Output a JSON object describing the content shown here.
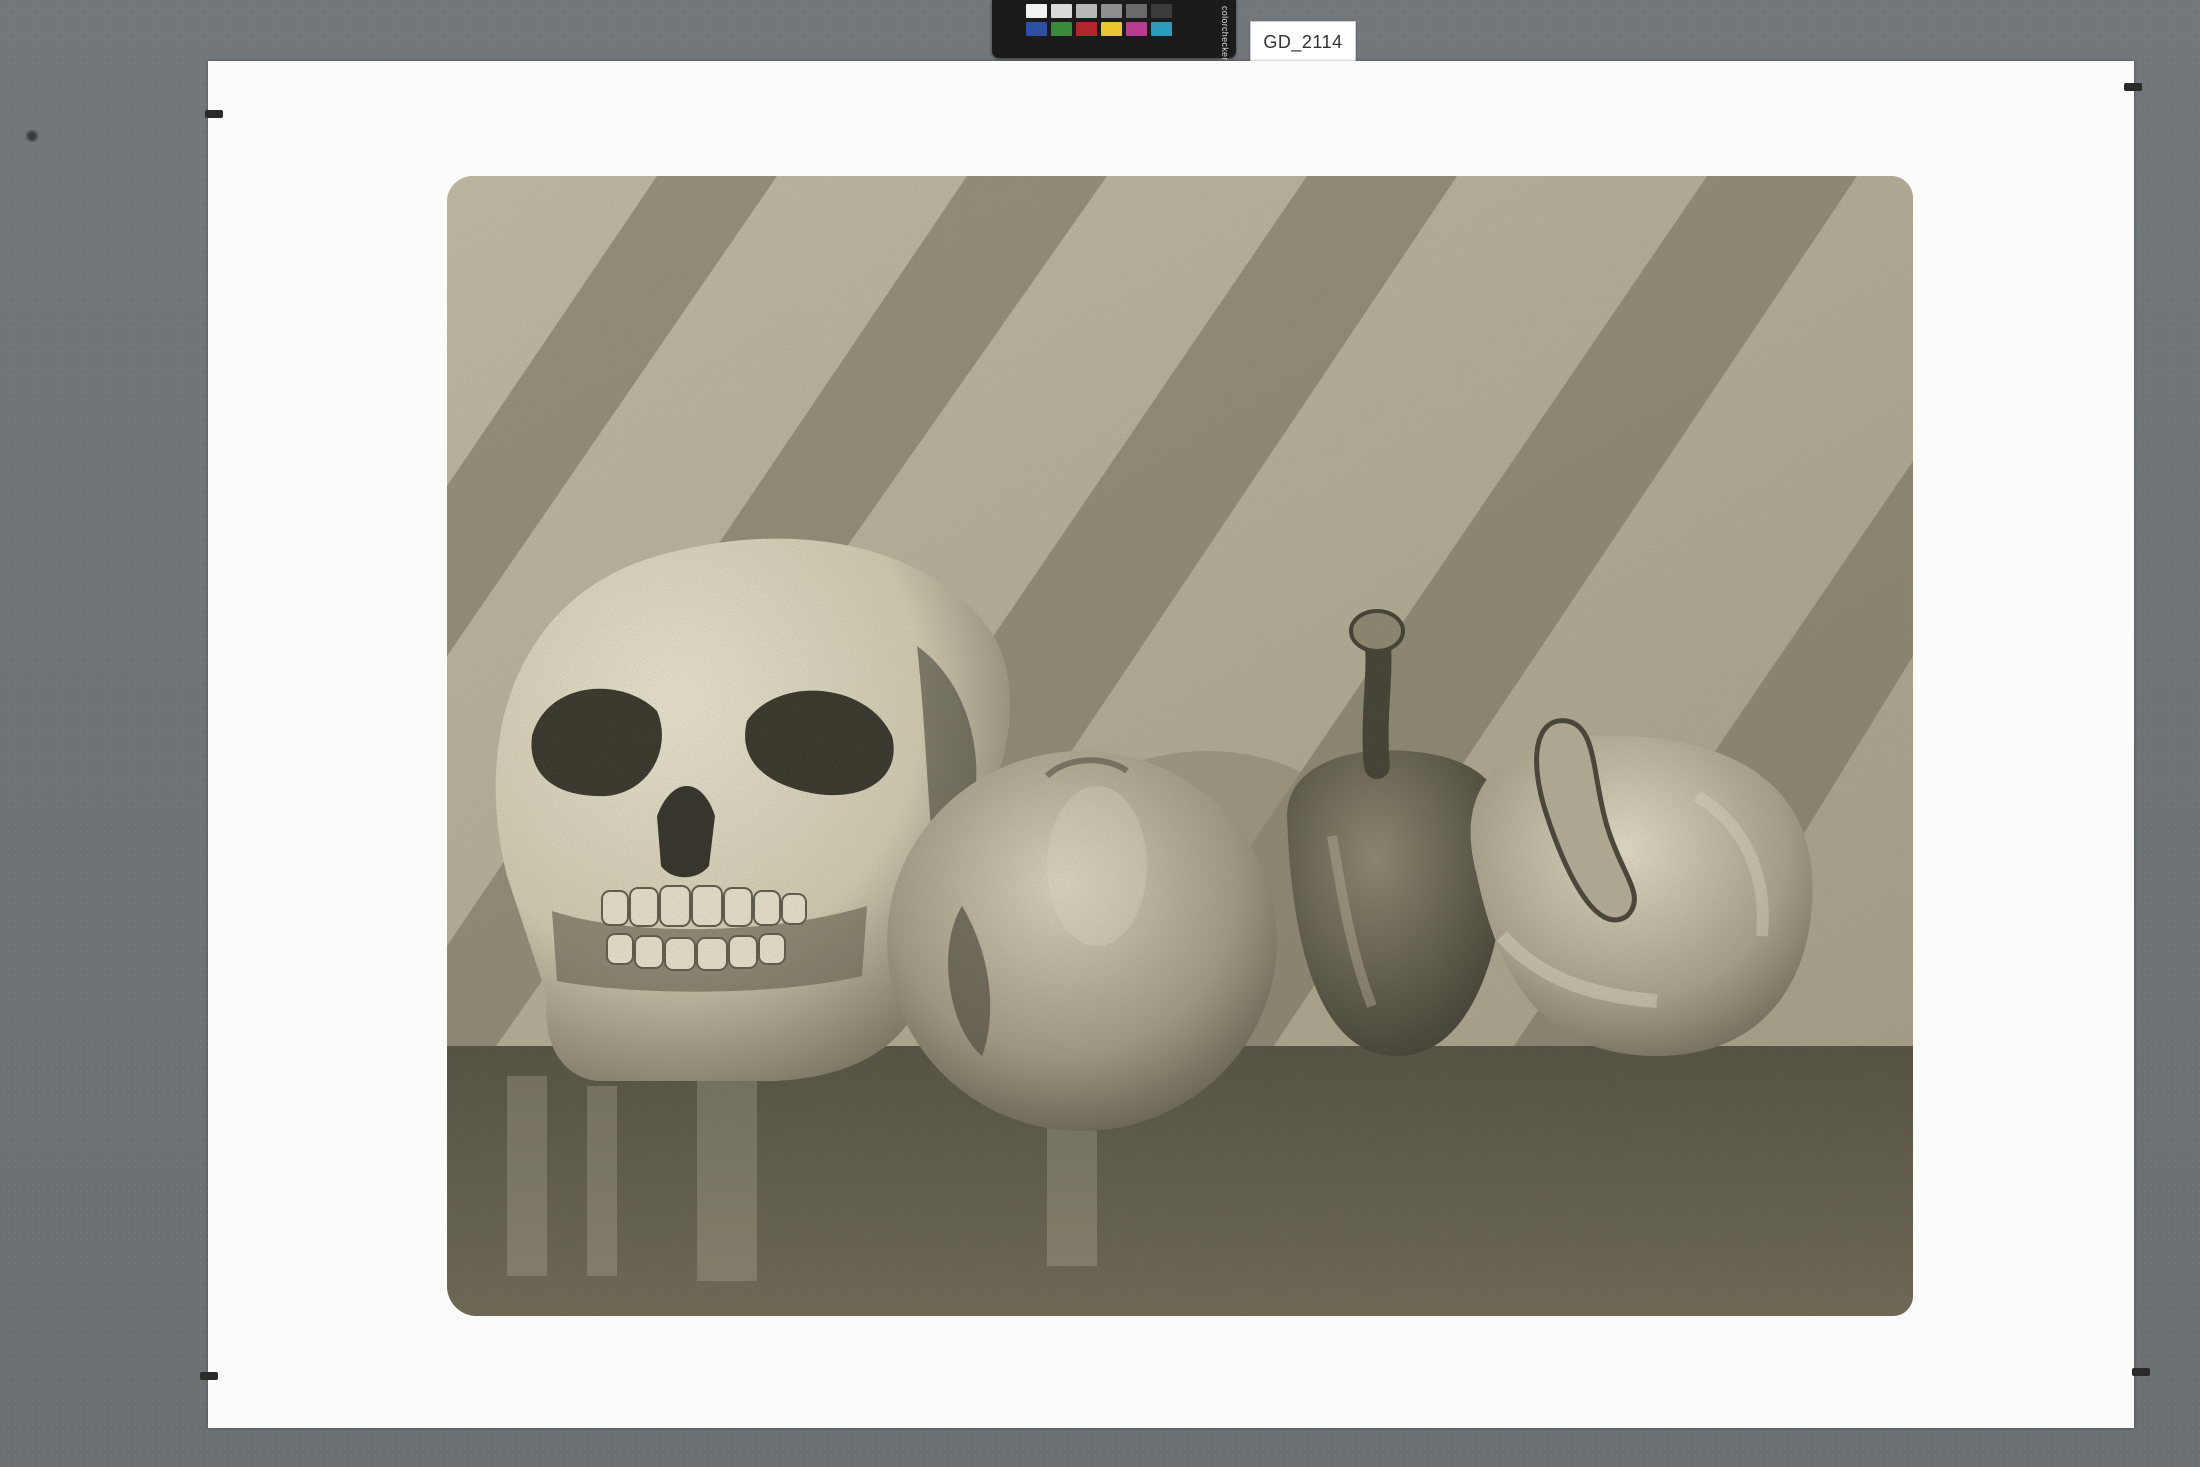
{
  "inventory_tag": "GD_2114",
  "color_checker": {
    "brand": "colorchecker",
    "row1": [
      "#f2f2f0",
      "#d9d9d7",
      "#b8b8b6",
      "#8f8f8d",
      "#6a6a68",
      "#3c3c3b"
    ],
    "row2": [
      "#2e4fa6",
      "#3a8a3c",
      "#b3262c",
      "#e8c72a",
      "#b83c8f",
      "#2a9bbd"
    ]
  },
  "colors": {
    "board": "#6e7377",
    "sheet": "#fbfbf9",
    "print_light": "#d8d2bc",
    "print_shadow": "#5a5648"
  },
  "artwork": {
    "subject": "still-life-skull-fruit-peppers"
  }
}
